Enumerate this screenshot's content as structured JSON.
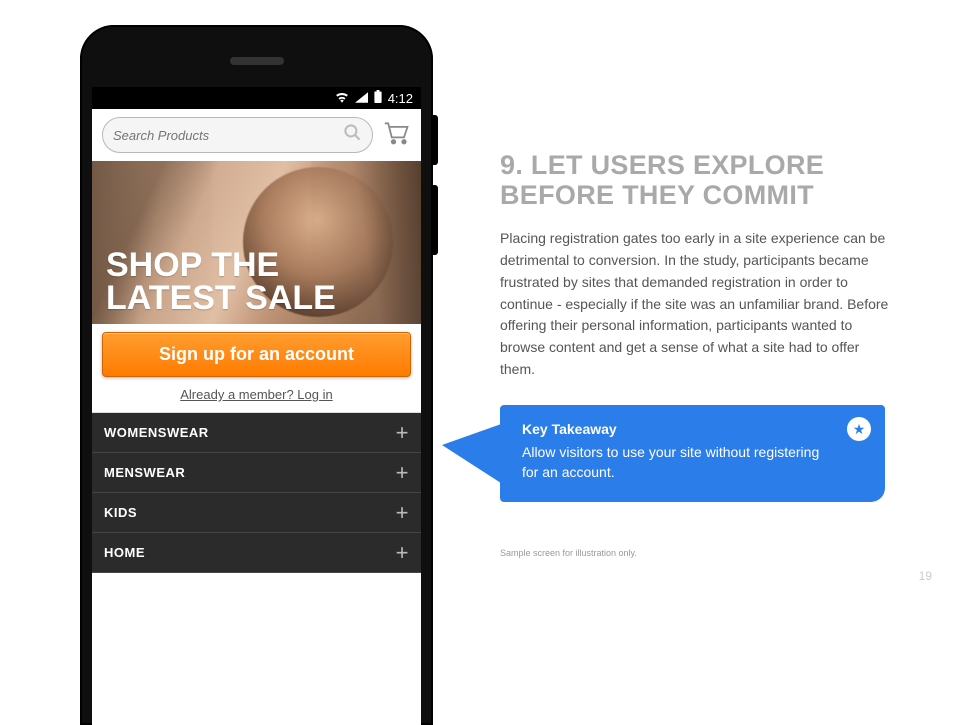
{
  "phone": {
    "status_time": "4:12",
    "search_placeholder": "Search Products",
    "hero_line1": "SHOP THE",
    "hero_line2": "LATEST SALE",
    "signup_label": "Sign up for an account",
    "login_label": "Already a member? Log in",
    "categories": [
      "WOMENSWEAR",
      "MENSWEAR",
      "KIDS",
      "HOME"
    ]
  },
  "article": {
    "heading": "9. LET USERS EXPLORE BEFORE THEY COMMIT",
    "body": "Placing registration gates too early in a site experience can be detrimental to conversion. In the study, participants became frustrated by sites that demanded registration in order to continue - especially if the site was an unfamiliar brand. Before offering their personal information, participants wanted to browse content and get a sense of what a site had to offer them.",
    "callout_title": "Key Takeaway",
    "callout_body": "Allow visitors to use your site without registering for an account.",
    "footnote": "Sample screen for illustration only.",
    "page_number": "19"
  }
}
